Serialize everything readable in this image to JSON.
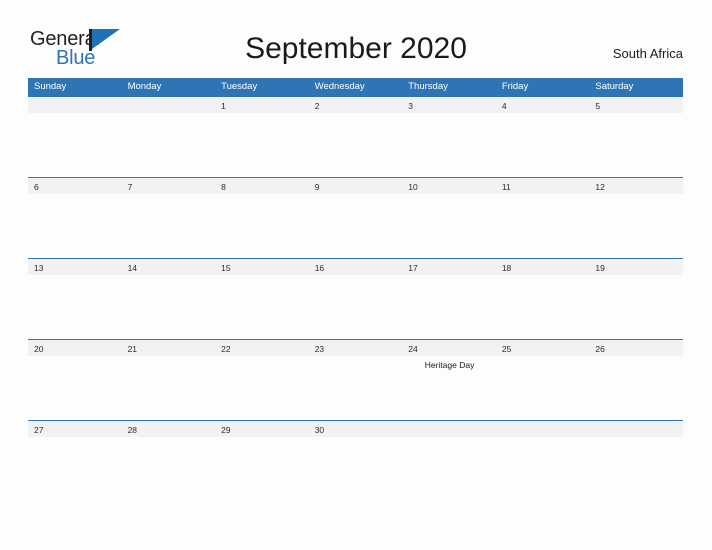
{
  "brand": {
    "word_one": "General",
    "word_two": "Blue",
    "flag_icon": "flag-triangle-icon",
    "accent_color": "#2e75b6"
  },
  "header": {
    "title": "September 2020",
    "country": "South Africa"
  },
  "calendar": {
    "month": "September",
    "year": "2020",
    "weekday_headers": [
      "Sunday",
      "Monday",
      "Tuesday",
      "Wednesday",
      "Thursday",
      "Friday",
      "Saturday"
    ],
    "weeks": [
      [
        {
          "day": "",
          "event": ""
        },
        {
          "day": "",
          "event": ""
        },
        {
          "day": "1",
          "event": ""
        },
        {
          "day": "2",
          "event": ""
        },
        {
          "day": "3",
          "event": ""
        },
        {
          "day": "4",
          "event": ""
        },
        {
          "day": "5",
          "event": ""
        }
      ],
      [
        {
          "day": "6",
          "event": ""
        },
        {
          "day": "7",
          "event": ""
        },
        {
          "day": "8",
          "event": ""
        },
        {
          "day": "9",
          "event": ""
        },
        {
          "day": "10",
          "event": ""
        },
        {
          "day": "11",
          "event": ""
        },
        {
          "day": "12",
          "event": ""
        }
      ],
      [
        {
          "day": "13",
          "event": ""
        },
        {
          "day": "14",
          "event": ""
        },
        {
          "day": "15",
          "event": ""
        },
        {
          "day": "16",
          "event": ""
        },
        {
          "day": "17",
          "event": ""
        },
        {
          "day": "18",
          "event": ""
        },
        {
          "day": "19",
          "event": ""
        }
      ],
      [
        {
          "day": "20",
          "event": ""
        },
        {
          "day": "21",
          "event": ""
        },
        {
          "day": "22",
          "event": ""
        },
        {
          "day": "23",
          "event": ""
        },
        {
          "day": "24",
          "event": "Heritage Day"
        },
        {
          "day": "25",
          "event": ""
        },
        {
          "day": "26",
          "event": ""
        }
      ],
      [
        {
          "day": "27",
          "event": ""
        },
        {
          "day": "28",
          "event": ""
        },
        {
          "day": "29",
          "event": ""
        },
        {
          "day": "30",
          "event": ""
        },
        {
          "day": "",
          "event": ""
        },
        {
          "day": "",
          "event": ""
        },
        {
          "day": "",
          "event": ""
        }
      ]
    ]
  }
}
